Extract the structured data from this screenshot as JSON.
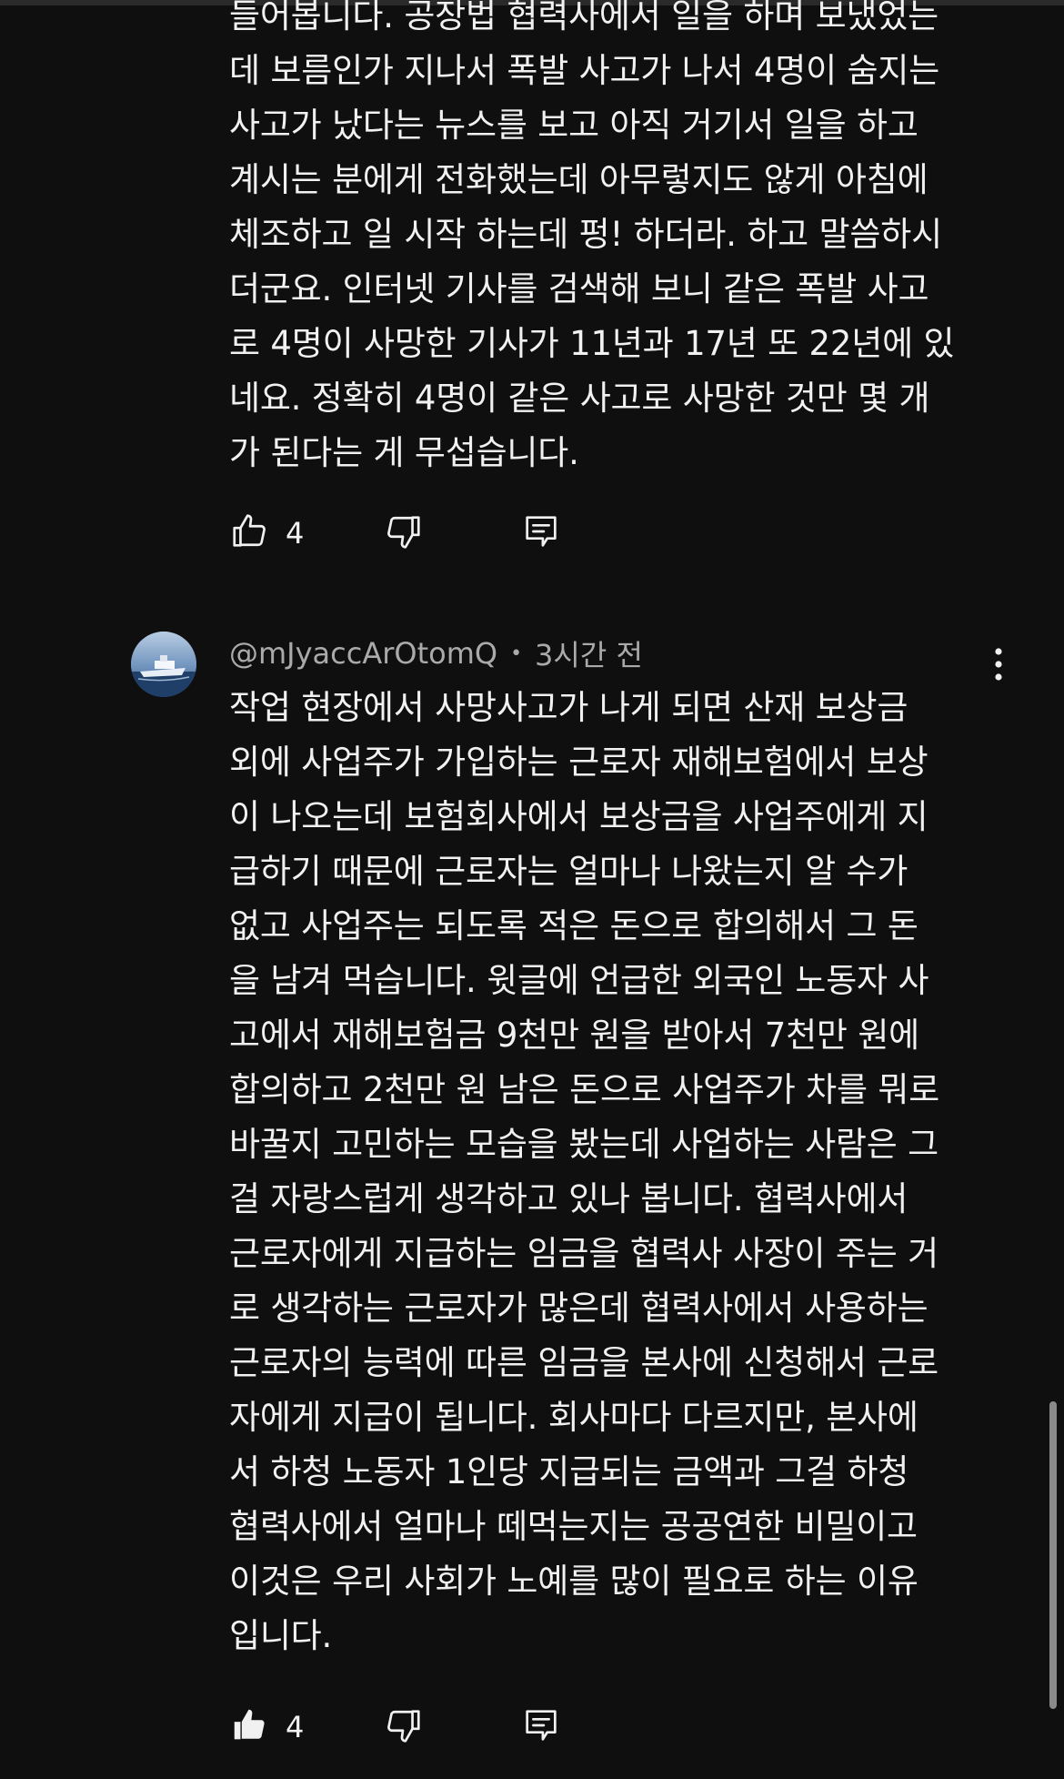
{
  "comments": [
    {
      "text": "들어봅니다. 공장법 협력사에서 일을 하며 보냈었는\n데 보름인가 지나서 폭발 사고가 나서 4명이 숨지는\n사고가 났다는 뉴스를 보고 아직 거기서 일을 하고\n계시는 분에게 전화했는데 아무렇지도 않게 아침에\n체조하고 일 시작 하는데 펑! 하더라. 하고 말씀하시\n더군요. 인터넷 기사를 검색해 보니 같은 폭발 사고\n로 4명이 사망한 기사가 11년과 17년 또 22년에 있\n네요. 정확히 4명이 같은 사고로 사망한 것만 몇 개\n가 된다는 게 무섭습니다.",
      "like_count": "4",
      "icons": {
        "like": "thumbs-up-outline-icon",
        "dislike": "thumbs-down-outline-icon",
        "reply": "reply-icon"
      }
    },
    {
      "author": "@mJyaccArOtomQ",
      "separator": "•",
      "timestamp": "3시간 전",
      "avatar_icon": "ship-avatar",
      "text": "작업 현장에서 사망사고가 나게 되면 산재 보상금\n외에 사업주가 가입하는 근로자 재해보험에서 보상\n이 나오는데 보험회사에서 보상금을 사업주에게 지\n급하기 때문에 근로자는 얼마나 나왔는지 알 수가\n없고 사업주는 되도록 적은 돈으로 합의해서 그 돈\n을 남겨 먹습니다. 윗글에 언급한 외국인 노동자 사\n고에서 재해보험금 9천만 원을 받아서 7천만 원에\n합의하고 2천만 원 남은 돈으로 사업주가 차를 뭐로\n바꿀지 고민하는 모습을 봤는데 사업하는 사람은 그\n걸 자랑스럽게 생각하고 있나 봅니다. 협력사에서\n근로자에게 지급하는 임금을 협력사 사장이 주는 거\n로 생각하는 근로자가 많은데 협력사에서 사용하는\n근로자의 능력에 따른 임금을 본사에 신청해서 근로\n자에게 지급이 됩니다. 회사마다 다르지만, 본사에\n서 하청 노동자 1인당 지급되는 금액과 그걸 하청\n협력사에서 얼마나 떼먹는지는 공공연한 비밀이고\n이것은 우리 사회가 노예를 많이 필요로 하는 이유\n입니다.",
      "like_count": "4",
      "liked": true,
      "icons": {
        "like": "thumbs-up-filled-icon",
        "dislike": "thumbs-down-outline-icon",
        "reply": "reply-icon",
        "more": "more-vertical-icon"
      }
    }
  ],
  "colors": {
    "background": "#0f0f0f",
    "text": "#f1f1f1",
    "secondary_text": "#aaaaaa",
    "scrollbar": "#8a8a8a"
  }
}
